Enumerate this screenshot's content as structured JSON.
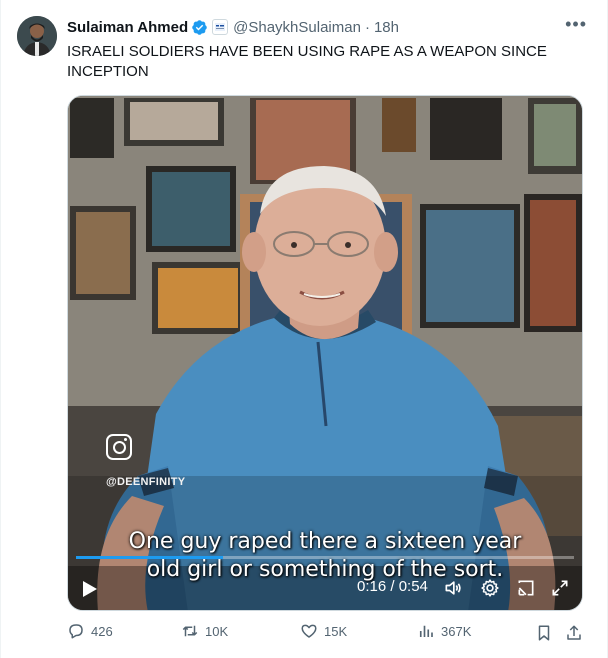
{
  "tweet": {
    "author_name": "Sulaiman Ahmed",
    "handle": "@ShaykhSulaiman",
    "separator": "·",
    "time": "18h",
    "more_label": "•••",
    "text": "ISRAELI SOLDIERS HAVE BEEN USING RAPE AS A WEAPON SINCE INCEPTION"
  },
  "media": {
    "watermark": "@DEENFINITY",
    "caption_line1": "One guy raped there a sixteen year",
    "caption_line2": "old girl or something of the sort.",
    "time_display": "0:16 / 0:54",
    "progress": 0.296
  },
  "actions": {
    "replies": "426",
    "reposts": "10K",
    "likes": "15K",
    "views": "367K"
  },
  "colors": {
    "accent": "#1d9bf0",
    "muted": "#536471",
    "text": "#0f1419"
  }
}
